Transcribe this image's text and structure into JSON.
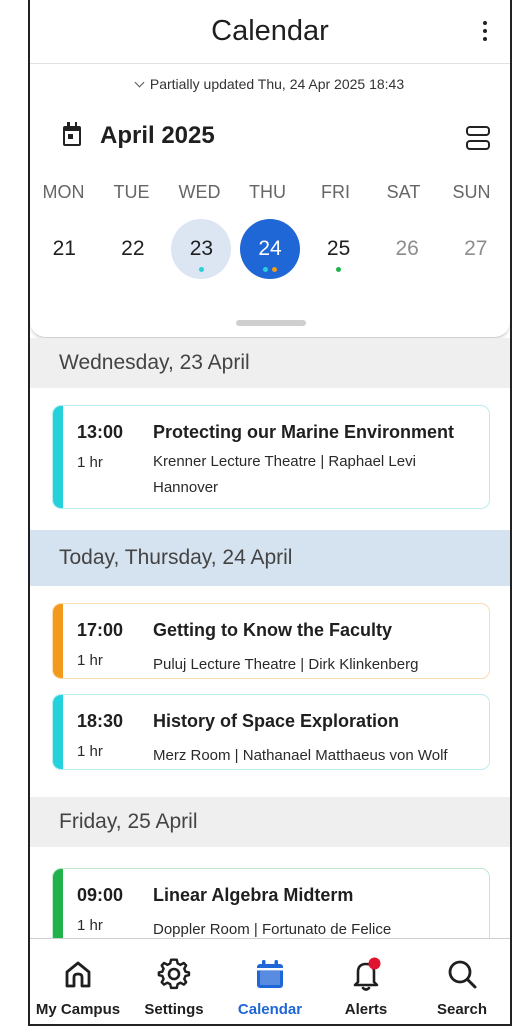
{
  "header": {
    "title": "Calendar"
  },
  "sync_status": "Partially updated Thu, 24 Apr 2025 18:43",
  "month_label": "April 2025",
  "weekdays": [
    "MON",
    "TUE",
    "WED",
    "THU",
    "FRI",
    "SAT",
    "SUN"
  ],
  "days": [
    {
      "num": "21",
      "state": "normal",
      "dots": []
    },
    {
      "num": "22",
      "state": "normal",
      "dots": []
    },
    {
      "num": "23",
      "state": "selected",
      "dots": [
        "#25d2dc"
      ]
    },
    {
      "num": "24",
      "state": "today",
      "dots": [
        "#25d2dc",
        "#f39a1c"
      ]
    },
    {
      "num": "25",
      "state": "normal",
      "dots": [
        "#22b24c"
      ]
    },
    {
      "num": "26",
      "state": "muted",
      "dots": []
    },
    {
      "num": "27",
      "state": "muted",
      "dots": []
    }
  ],
  "sections": [
    {
      "heading": "Wednesday, 23 April",
      "today": false,
      "events": [
        {
          "time": "13:00",
          "duration": "1 hr",
          "title": "Protecting our Marine Environment",
          "location": "Krenner Lecture Theatre | Raphael Levi",
          "location_2": "Hannover",
          "color": "#25d2dc"
        }
      ]
    },
    {
      "heading": "Today, Thursday, 24 April",
      "today": true,
      "events": [
        {
          "time": "17:00",
          "duration": "1 hr",
          "title": "Getting to Know the Faculty",
          "location": "Puluj Lecture Theatre | Dirk Klinkenberg",
          "color": "#f39a1c"
        },
        {
          "time": "18:30",
          "duration": "1 hr",
          "title": "History of Space Exploration",
          "location": "Merz Room | Nathanael Matthaeus von Wolf",
          "color": "#25d2dc"
        }
      ]
    },
    {
      "heading": "Friday, 25 April",
      "today": false,
      "events": [
        {
          "time": "09:00",
          "duration": "1 hr",
          "title": "Linear Algebra Midterm",
          "location": "Doppler Room | Fortunato de Felice",
          "color": "#22b24c"
        }
      ]
    }
  ],
  "nav": [
    {
      "label": "My Campus",
      "icon": "home-icon"
    },
    {
      "label": "Settings",
      "icon": "gear-icon"
    },
    {
      "label": "Calendar",
      "icon": "calendar-icon",
      "active": true
    },
    {
      "label": "Alerts",
      "icon": "bell-icon",
      "badge": true
    },
    {
      "label": "Search",
      "icon": "search-icon"
    }
  ],
  "colors": {
    "accent": "#1f66d6",
    "badge": "#e0142f"
  }
}
